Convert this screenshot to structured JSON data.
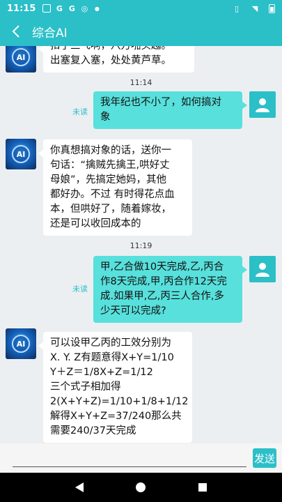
{
  "status": {
    "time": "11:15"
  },
  "header": {
    "title": "综合AI"
  },
  "messages": [
    {
      "side": "left",
      "lines": [
        "出塞复入塞，处处黄芦草。"
      ],
      "partial_top": "扣了三飞啊，八万啪头越。"
    },
    {
      "type": "time",
      "text": "11:14"
    },
    {
      "side": "right",
      "lines": [
        "我年纪也不小了，如何搞对",
        "象"
      ],
      "status": "未读"
    },
    {
      "side": "left",
      "lines": [
        "你真想搞对象的话，送你一",
        "句话：“擒贼先擒王,哄好丈",
        "母娘”，先搞定她妈，其他",
        "都好办。不过 有时得花点血",
        "本，但哄好了，随着嫁妆，",
        "还是可以收回成本的"
      ]
    },
    {
      "type": "time",
      "text": "11:19"
    },
    {
      "side": "right",
      "lines": [
        "甲,乙合做10天完成,乙,丙合",
        "作8天完成,甲,丙合作12天完",
        "成.如果甲,乙,丙三人合作,多",
        "少天可以完成?"
      ],
      "status": "未读"
    },
    {
      "side": "left",
      "lines": [
        "可以设甲乙丙的工效分别为",
        "X. Y. Z有题意得X+Y=1/10",
        "Y＋Z＝1/8X+Z=1/12",
        "三个式子相加得",
        "2(X+Y+Z)=1/10+1/8+1/12",
        "解得X+Y+Z=37/240那么共",
        "需要240/37天完成"
      ]
    }
  ],
  "input": {
    "placeholder": "",
    "value": ""
  },
  "send_label": "发送",
  "avatar_ai_text": "AI",
  "colors": {
    "accent": "#2bbfc8",
    "bubble_right": "#58e0dc",
    "background": "#eceff1"
  }
}
